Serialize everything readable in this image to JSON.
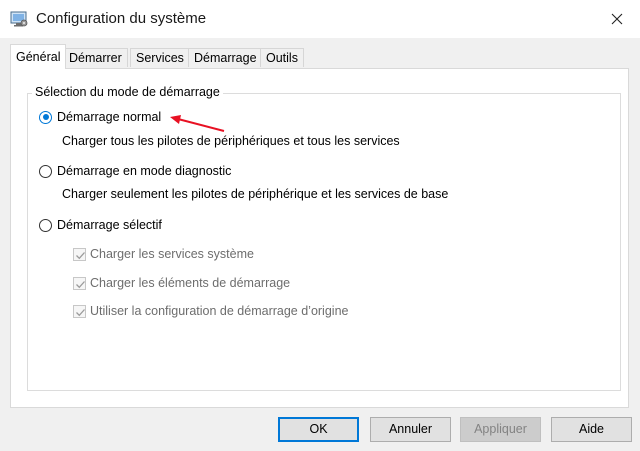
{
  "window": {
    "title": "Configuration du système",
    "icon": "system-config-icon",
    "close_icon": "close-icon"
  },
  "tabs": [
    {
      "label": "Général",
      "active": true
    },
    {
      "label": "Démarrer",
      "active": false
    },
    {
      "label": "Services",
      "active": false
    },
    {
      "label": "Démarrage",
      "active": false
    },
    {
      "label": "Outils",
      "active": false
    }
  ],
  "startup_group": {
    "legend": "Sélection du mode de démarrage",
    "options": [
      {
        "label": "Démarrage normal",
        "description": "Charger tous les pilotes de périphériques et tous les services",
        "selected": true
      },
      {
        "label": "Démarrage en mode diagnostic",
        "description": "Charger seulement les pilotes de périphérique et les services de base",
        "selected": false
      },
      {
        "label": "Démarrage sélectif",
        "selected": false
      }
    ],
    "selective_items": [
      {
        "label": "Charger les services système",
        "checked": true,
        "enabled": false
      },
      {
        "label": "Charger les éléments de démarrage",
        "checked": true,
        "enabled": false
      },
      {
        "label": "Utiliser la configuration de démarrage d’origine",
        "checked": true,
        "enabled": false
      }
    ]
  },
  "annotation": {
    "arrow_color": "#e81123"
  },
  "buttons": {
    "ok": "OK",
    "cancel": "Annuler",
    "apply": "Appliquer",
    "help": "Aide"
  },
  "colors": {
    "accent": "#0078d7",
    "panel": "#ffffff",
    "chrome": "#f0f0f0"
  }
}
